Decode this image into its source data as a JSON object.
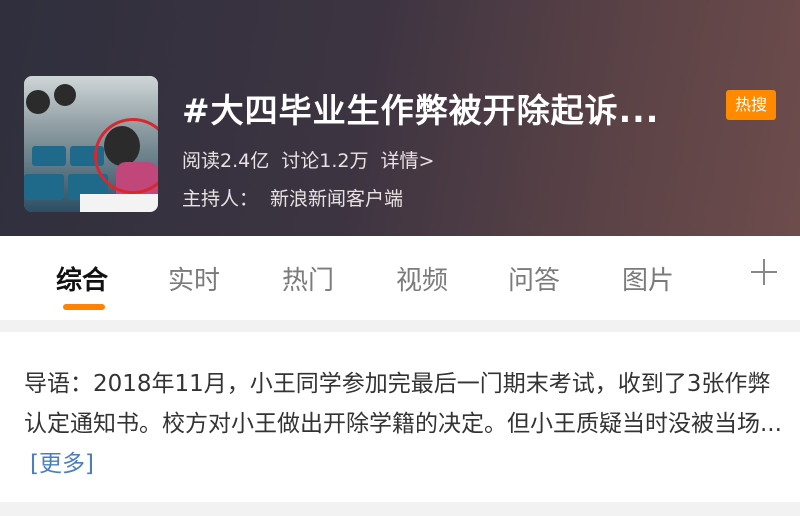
{
  "topic": {
    "title": "#大四毕业生作弊被开除起诉...",
    "badge": "热搜",
    "stats": {
      "reads": "阅读2.4亿",
      "discussions": "讨论1.2万",
      "details": "详情>"
    },
    "host_label": "主持人：",
    "host_name": "新浪新闻客户端"
  },
  "tabs": [
    {
      "label": "综合",
      "active": true
    },
    {
      "label": "实时",
      "active": false
    },
    {
      "label": "热门",
      "active": false
    },
    {
      "label": "视频",
      "active": false
    },
    {
      "label": "问答",
      "active": false
    },
    {
      "label": "图片",
      "active": false
    }
  ],
  "intro": {
    "text": "导语：2018年11月，小王同学参加完最后一门期末考试，收到了3张作弊认定通知书。校方对小王做出开除学籍的决定。但小王质疑当时没被当场...",
    "more": "[更多]"
  },
  "colors": {
    "accent": "#ff8200",
    "badge": "#ff8a00",
    "link": "#4a7fbf"
  }
}
